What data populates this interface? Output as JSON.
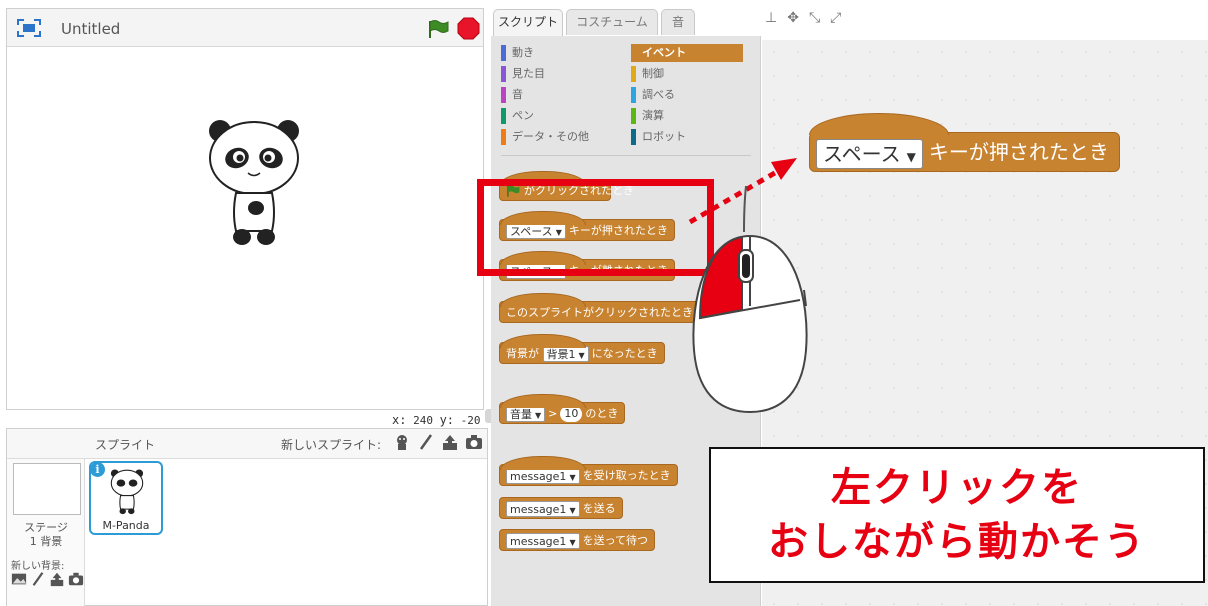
{
  "stage": {
    "title": "Untitled",
    "icons": {
      "fullscreen": "fullscreen-icon",
      "green_flag": "green-flag-icon",
      "stop": "stop-icon"
    },
    "colors": {
      "flag": "#3c8b24",
      "stop": "#e8142a"
    }
  },
  "coordinates": {
    "x_label": "x:",
    "x_value": "240",
    "y_label": "y:",
    "y_value": "-20"
  },
  "sprite_library": {
    "title": "スプライト",
    "new_sprite_label": "新しいスプライト:",
    "stage_label_line1": "ステージ",
    "stage_label_line2": "1 背景",
    "new_backdrop_label": "新しい背景:",
    "sprites": [
      {
        "name": "M-Panda",
        "selected": true
      }
    ]
  },
  "tabs": [
    {
      "label": "スクリプト",
      "active": true
    },
    {
      "label": "コスチューム",
      "active": false
    },
    {
      "label": "音",
      "active": false
    }
  ],
  "categories": [
    {
      "label": "動き",
      "color": "#4a6cd4"
    },
    {
      "label": "見た目",
      "color": "#8a55d7"
    },
    {
      "label": "音",
      "color": "#bb42c3"
    },
    {
      "label": "ペン",
      "color": "#0e9a6c"
    },
    {
      "label": "データ・その他",
      "color": "#ee7d16"
    },
    {
      "label": "イベント",
      "color": "#c88330",
      "selected": true
    },
    {
      "label": "制御",
      "color": "#e1a91a"
    },
    {
      "label": "調べる",
      "color": "#2ca5e2"
    },
    {
      "label": "演算",
      "color": "#5cb712"
    },
    {
      "label": "ロボット",
      "color": "#0b6b8b"
    }
  ],
  "blocks": {
    "flag_clicked": "がクリックされたとき",
    "key_pressed": {
      "key": "スペース",
      "text": "キーが押されたとき"
    },
    "key_released": {
      "key": "スペース",
      "text": "キーが離されたとき"
    },
    "sprite_clicked": "このスプライトがクリックされたとき",
    "backdrop_switch": {
      "prefix": "背景が",
      "backdrop": "背景1",
      "suffix": "になったとき"
    },
    "loudness": {
      "sensor": "音量",
      "op": ">",
      "value": "10",
      "suffix": "のとき"
    },
    "receive": {
      "message": "message1",
      "text": "を受け取ったとき"
    },
    "broadcast": {
      "message": "message1",
      "text": "を送る"
    },
    "broadcast_wait": {
      "message": "message1",
      "text": "を送って待つ"
    }
  },
  "script_area": {
    "dragged_block": {
      "key": "スペース",
      "text": "キーが押されたとき"
    }
  },
  "annotation": {
    "caption_line1": "左クリックを",
    "caption_line2": "おしながら動かそう",
    "color": "#e60012"
  },
  "block_color": "#c88330"
}
